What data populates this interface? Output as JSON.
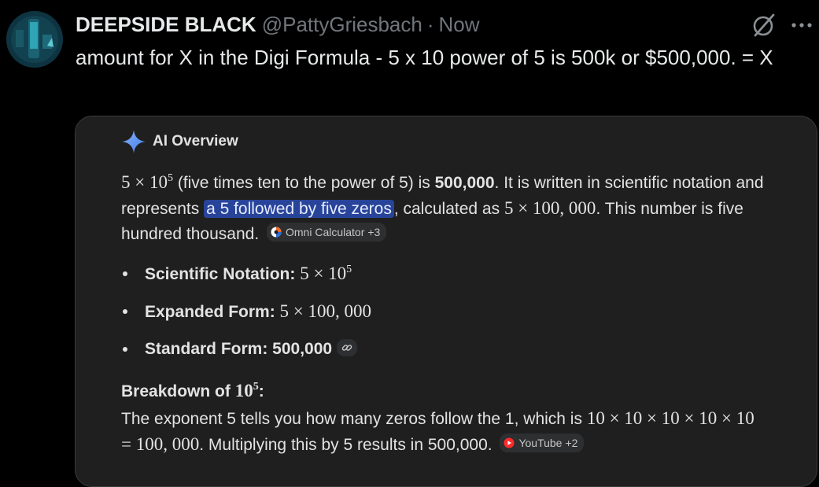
{
  "tweet": {
    "display_name": "DEEPSIDE BLACK",
    "handle": "@PattyGriesbach",
    "separator": "·",
    "time": "Now",
    "text": "amount for X in the Digi Formula - 5 x 10 power of 5 is 500k or $500,000. = X",
    "icons": {
      "grok": "grok-icon",
      "more": "more-icon"
    }
  },
  "ai_overview": {
    "title": "AI Overview",
    "icon": "sparkle-icon",
    "intro": {
      "math_base": "5 × 10",
      "math_exp": "5",
      "text1": " (five times ten to the power of 5) is ",
      "value": "500,000",
      "text2": ". It is written in scientific notation and represents ",
      "highlight": "a 5 followed by five zeros",
      "text3": ", calculated as ",
      "math2": "5 × 100, 000",
      "text4": ". This number is five hundred thousand.",
      "source": {
        "name": "Omni Calculator",
        "count": "+3",
        "icon": "omni-calculator-icon"
      }
    },
    "bullets": [
      {
        "label": "Scientific Notation: ",
        "math_base": "5 × 10",
        "math_exp": "5"
      },
      {
        "label": "Expanded Form: ",
        "math": "5 × 100, 000"
      },
      {
        "label": "Standard Form: 500,000",
        "icon": "link-icon"
      }
    ],
    "breakdown": {
      "title_prefix": "Breakdown of ",
      "title_math_base": "10",
      "title_math_exp": "5",
      "title_suffix": ":",
      "text1": "The exponent 5 tells you how many zeros follow the 1, which is ",
      "math1": "10 × 10 × 10 × 10 × 10",
      "math2": "= 100, 000",
      "text2": ". Multiplying this by 5 results in 500,000.",
      "source": {
        "name": "YouTube",
        "count": "+2",
        "icon": "youtube-icon"
      }
    }
  },
  "colors": {
    "background": "#000000",
    "card": "#1f1f1f",
    "highlight": "#28449a",
    "muted": "#71767b",
    "sparkle": "#4f8df5"
  }
}
